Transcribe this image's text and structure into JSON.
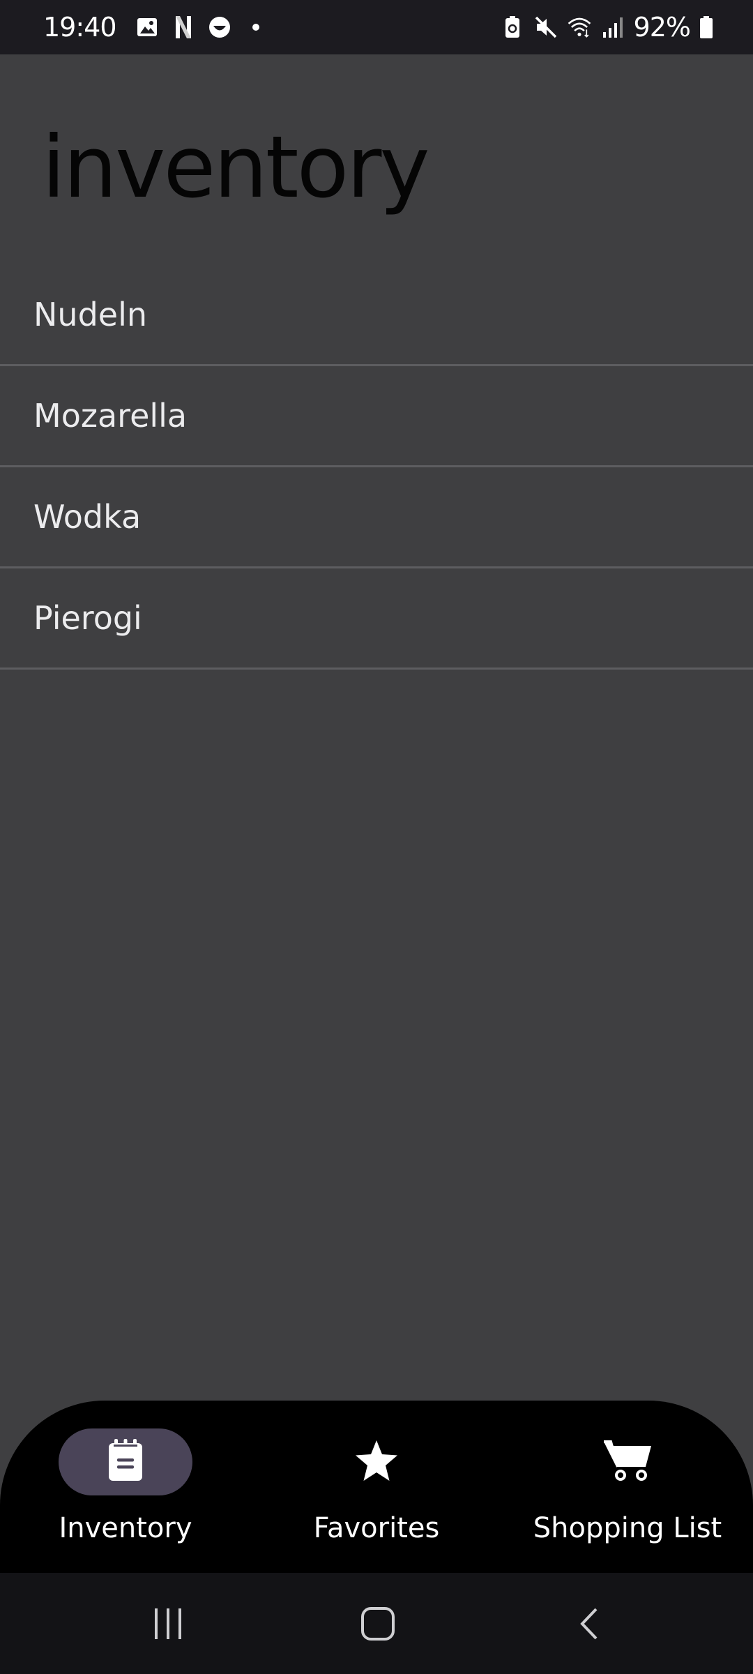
{
  "status_bar": {
    "time": "19:40",
    "battery_percent": "92%",
    "left_icons": [
      "gallery-icon",
      "netflix-icon",
      "face-icon",
      "dot-icon"
    ],
    "right_icons": [
      "battery-saver-icon",
      "mute-icon",
      "wifi-icon",
      "signal-icon",
      "battery-icon"
    ]
  },
  "page": {
    "title": "inventory"
  },
  "inventory": {
    "items": [
      {
        "label": "Nudeln"
      },
      {
        "label": "Mozarella"
      },
      {
        "label": "Wodka"
      },
      {
        "label": "Pierogi"
      }
    ]
  },
  "bottom_nav": {
    "items": [
      {
        "label": "Inventory",
        "icon": "notepad-icon",
        "active": true
      },
      {
        "label": "Favorites",
        "icon": "star-icon",
        "active": false
      },
      {
        "label": "Shopping List",
        "icon": "cart-icon",
        "active": false
      }
    ],
    "active_pill_color": "#4a4458"
  },
  "system_nav": {
    "buttons": [
      "recent-apps-icon",
      "home-icon",
      "back-icon"
    ]
  },
  "colors": {
    "background": "#3f3f41",
    "status_bar": "#1c1b20",
    "bottom_nav": "#000000",
    "system_nav": "#131316",
    "divider": "#5d5d60"
  }
}
